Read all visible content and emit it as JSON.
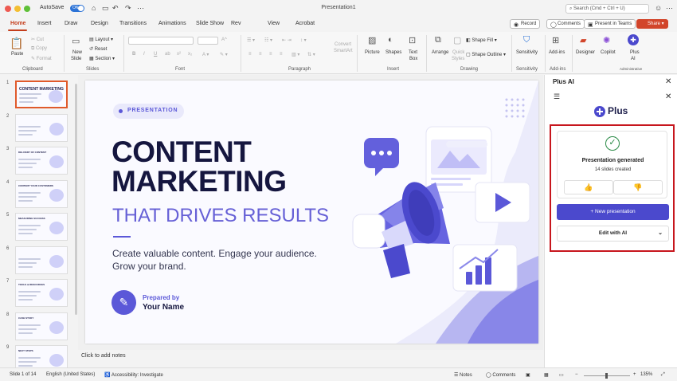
{
  "titlebar": {
    "autosave_label": "AutoSave",
    "autosave_state": "ON",
    "doc_title": "Presentation1",
    "search_placeholder": "Search (Cmd + Ctrl + U)"
  },
  "tabs": [
    "Home",
    "Insert",
    "Draw",
    "Design",
    "Transitions",
    "Animations",
    "Slide Show",
    "Rev",
    "View",
    "Acrobat"
  ],
  "header_buttons": {
    "record": "Record",
    "comments": "Comments",
    "present_teams": "Present in Teams",
    "share": "Share"
  },
  "ribbon": {
    "paste": "Paste",
    "cut": "Cut",
    "copy": "Copy",
    "format": "Format",
    "new_slide_1": "New",
    "new_slide_2": "Slide",
    "layout": "Layout",
    "reset": "Reset",
    "section": "Section",
    "convert_1": "Convert",
    "convert_2": "SmartArt",
    "picture": "Picture",
    "shapes": "Shapes",
    "textbox_1": "Text",
    "textbox_2": "Box",
    "arrange": "Arrange",
    "quick_styles_1": "Quick",
    "quick_styles_2": "Styles",
    "shape_fill": "Shape Fill",
    "shape_outline": "Shape Outline",
    "sensitivity": "Sensitivity",
    "addins": "Add-ins",
    "designer": "Designer",
    "copilot": "Copilot",
    "plusai_1": "Plus",
    "plusai_2": "AI",
    "groups": {
      "clipboard": "Clipboard",
      "slides": "Slides",
      "font": "Font",
      "paragraph": "Paragraph",
      "insert": "Insert",
      "drawing": "Drawing",
      "sensitivity": "Sensitivity",
      "addins": "Add-ins",
      "admin": "Administrative"
    }
  },
  "thumbnails": [
    {
      "num": "1",
      "title": "CONTENT MARKETING"
    },
    {
      "num": "2",
      "title": ""
    },
    {
      "num": "3",
      "title": "DELIVERY OF CONTENT"
    },
    {
      "num": "4",
      "title": "CONTENT YOUR CUSTOMERS"
    },
    {
      "num": "5",
      "title": "MEASURING SUCCESS"
    },
    {
      "num": "6",
      "title": ""
    },
    {
      "num": "7",
      "title": "TOOLS & RESOURCES"
    },
    {
      "num": "8",
      "title": "CASE STUDY"
    },
    {
      "num": "9",
      "title": "NEXT STEPS"
    }
  ],
  "slide": {
    "tag": "PRESENTATION",
    "headline_1": "CONTENT",
    "headline_2": "MARKETING",
    "subheadline": "THAT DRIVES RESULTS",
    "body_1": "Create valuable content. Engage your audience.",
    "body_2": "Grow your brand.",
    "prepared_label": "Prepared by",
    "presenter": "Your Name"
  },
  "notes_placeholder": "Click to add notes",
  "pane": {
    "title": "Plus AI",
    "logo_text": "Plus",
    "generated_title": "Presentation generated",
    "slides_created": "14 slides created",
    "new_presentation": "+ New presentation",
    "edit_with_ai": "Edit with AI"
  },
  "status": {
    "slide_of": "Slide 1 of 14",
    "language": "English (United States)",
    "accessibility": "Accessibility: Investigate",
    "notes": "Notes",
    "comments": "Comments",
    "zoom": "135%"
  },
  "colors": {
    "accent": "#c43e1c",
    "brand_purple": "#5b58d8",
    "plus_ai": "#4b49cd",
    "highlight_box": "#c7161d"
  }
}
